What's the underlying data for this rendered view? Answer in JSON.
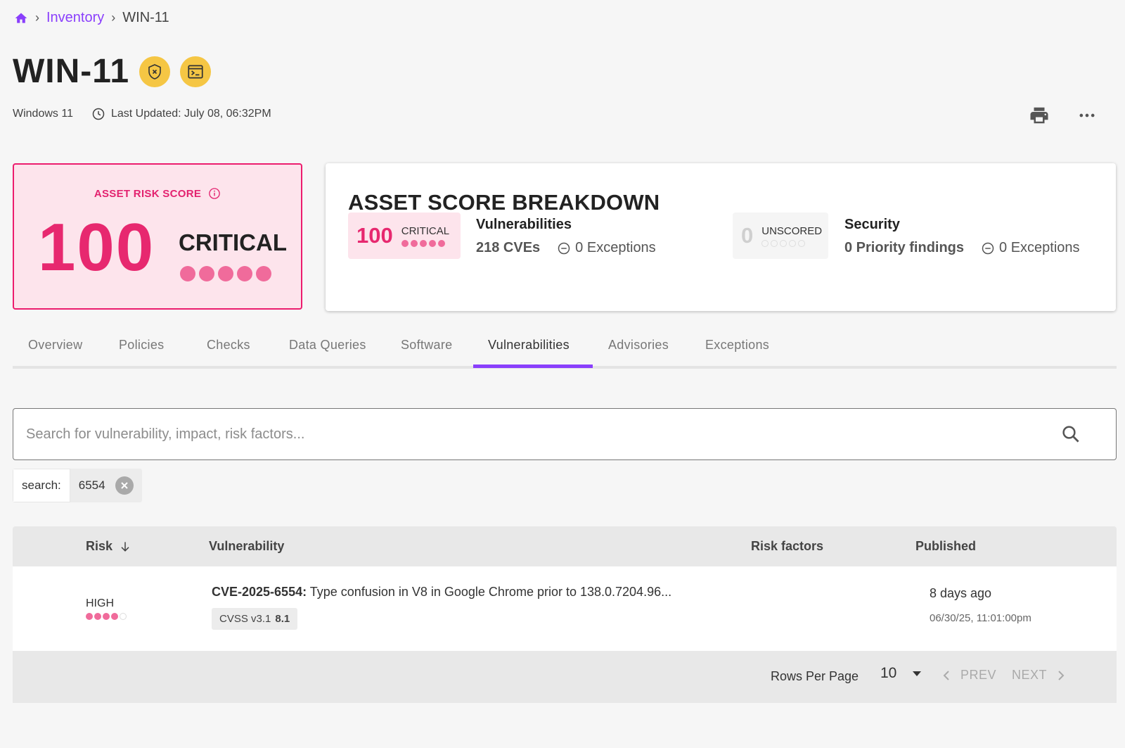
{
  "breadcrumb": {
    "home_icon": "home-icon",
    "items": [
      {
        "label": "Inventory"
      },
      {
        "label": "WIN-11"
      }
    ]
  },
  "asset": {
    "title": "WIN-11",
    "os": "Windows 11",
    "last_updated": "Last Updated: July 08, 06:32PM",
    "badges": [
      "shield-icon",
      "terminal-icon"
    ]
  },
  "risk_score": {
    "label": "ASSET RISK SCORE",
    "value": "100",
    "rating": "CRITICAL",
    "level": 5,
    "max": 5,
    "color": "#e7286f"
  },
  "breakdown": {
    "title": "ASSET SCORE BREAKDOWN",
    "vulnerabilities": {
      "score": "100",
      "rating": "CRITICAL",
      "level": 5,
      "heading": "Vulnerabilities",
      "main_stat": "218 CVEs",
      "exceptions": "0 Exceptions"
    },
    "security": {
      "score": "0",
      "rating": "UNSCORED",
      "level": 0,
      "heading": "Security",
      "main_stat": "0 Priority findings",
      "exceptions": "0 Exceptions"
    }
  },
  "tabs": [
    {
      "label": "Overview"
    },
    {
      "label": "Policies"
    },
    {
      "label": "Checks"
    },
    {
      "label": "Data Queries"
    },
    {
      "label": "Software"
    },
    {
      "label": "Vulnerabilities",
      "active": true
    },
    {
      "label": "Advisories"
    },
    {
      "label": "Exceptions"
    }
  ],
  "search": {
    "placeholder": "Search for vulnerability, impact, risk factors...",
    "value": ""
  },
  "filter": {
    "key": "search:",
    "value": "6554"
  },
  "table": {
    "headers": {
      "risk": "Risk",
      "vulnerability": "Vulnerability",
      "risk_factors": "Risk factors",
      "published": "Published"
    },
    "rows": [
      {
        "risk_label": "HIGH",
        "risk_level": 4,
        "cve_id": "CVE-2025-6554:",
        "description": " Type confusion in V8 in Google Chrome prior to 138.0.7204.96...",
        "cvss_label": "CVSS v3.1",
        "cvss_score": "8.1",
        "published_relative": "8 days ago",
        "published_absolute": "06/30/25, 11:01:00pm"
      }
    ]
  },
  "pagination": {
    "rows_per_page_label": "Rows Per Page",
    "rows_per_page": "10",
    "prev": "PREV",
    "next": "NEXT"
  },
  "colors": {
    "accent": "#8a3ffc",
    "critical": "#e7286f",
    "badge": "#f5c644"
  }
}
